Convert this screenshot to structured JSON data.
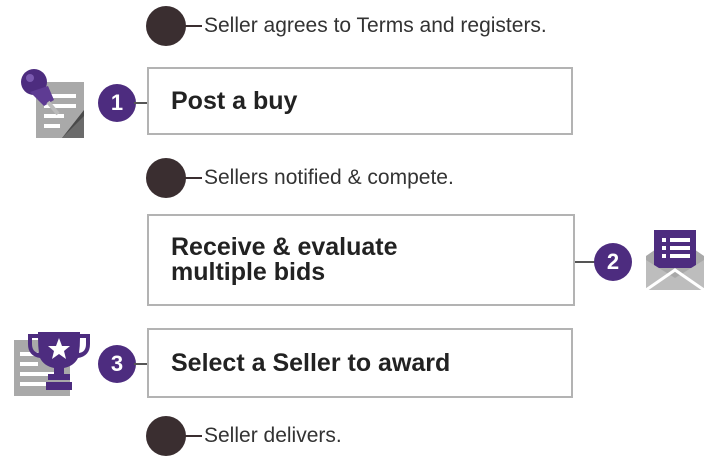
{
  "colors": {
    "accent": "#4d2c7f",
    "dot": "#3a2e30",
    "border": "#b3b3b3",
    "icon_gray": "#a9a9a9"
  },
  "notes": [
    {
      "text": "Seller agrees to Terms and registers."
    },
    {
      "text": "Sellers notified & compete."
    },
    {
      "text": "Seller delivers."
    }
  ],
  "steps": [
    {
      "number": "1",
      "label": "Post a buy",
      "icon": "pushpin-document-icon"
    },
    {
      "number": "2",
      "label_line1": "Receive & evaluate",
      "label_line2": "multiple bids",
      "icon": "envelope-list-icon"
    },
    {
      "number": "3",
      "label": "Select a Seller to award",
      "icon": "trophy-document-icon"
    }
  ]
}
